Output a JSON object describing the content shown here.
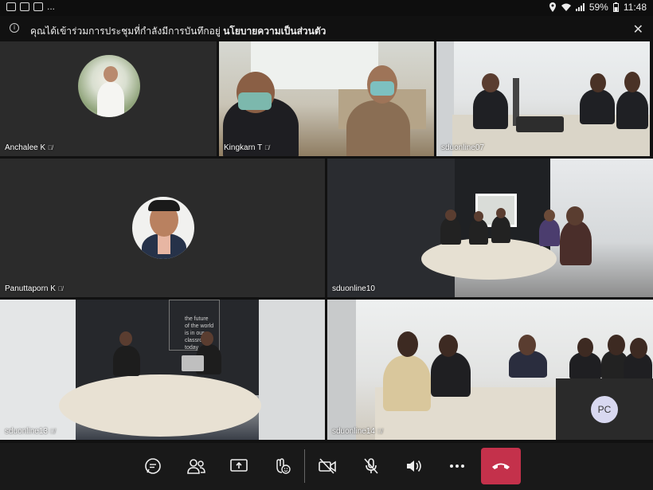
{
  "statusbar": {
    "left_icons": [
      "chat-notification-icon",
      "gallery-icon",
      "photo-icon"
    ],
    "more_indicator": "...",
    "battery": "59%",
    "time": "11:48"
  },
  "banner": {
    "message": "คุณได้เข้าร่วมการประชุมที่กำลังมีการบันทึกอยู่",
    "link": "นโยบายความเป็นส่วนตัว"
  },
  "participants": [
    {
      "name": "Anchalee K",
      "muted": true
    },
    {
      "name": "Kingkarn T",
      "muted": true
    },
    {
      "name": "sduonline07",
      "muted": false
    },
    {
      "name": "Panuttaporn K",
      "muted": true
    },
    {
      "name": "sduonline10",
      "muted": false
    },
    {
      "name": "sduonline13",
      "muted": true
    },
    {
      "name": "sduonline14",
      "muted": true
    }
  ],
  "wall_text": {
    "line1": "the future",
    "line2": "of the world",
    "line3": "is in our",
    "line4": "classrooms",
    "line5": "today"
  },
  "self_view": {
    "initials": "PC"
  },
  "controls": [
    "chat",
    "participants",
    "share",
    "reactions",
    "camera-off",
    "mic-off",
    "speaker",
    "more",
    "hang-up"
  ]
}
